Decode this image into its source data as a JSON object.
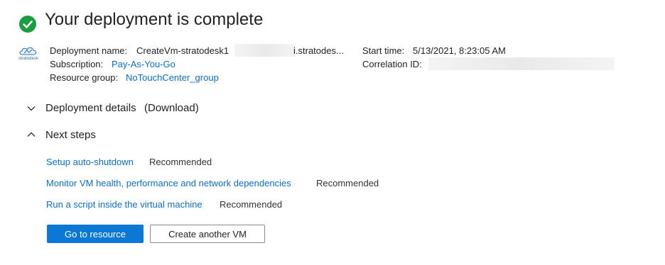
{
  "header": {
    "title": "Your deployment is complete"
  },
  "brand": {
    "logo_text": "stratodesk"
  },
  "deployment": {
    "name_label": "Deployment name:",
    "name_prefix": "CreateVm-stratodesk1",
    "name_suffix": "i.stratodes...",
    "subscription_label": "Subscription:",
    "subscription_value": "Pay-As-You-Go",
    "resource_group_label": "Resource group:",
    "resource_group_value": "NoTouchCenter_group",
    "start_time_label": "Start time:",
    "start_time_value": "5/13/2021, 8:23:05 AM",
    "correlation_label": "Correlation ID:"
  },
  "sections": {
    "details_label": "Deployment details",
    "download_link": "(Download)",
    "next_steps_label": "Next steps"
  },
  "next_steps": [
    {
      "link": "Setup auto-shutdown",
      "tag": "Recommended"
    },
    {
      "link": "Monitor VM health, performance and network dependencies",
      "tag": "Recommended"
    },
    {
      "link": "Run a script inside the virtual machine",
      "tag": "Recommended"
    }
  ],
  "actions": {
    "primary": "Go to resource",
    "secondary": "Create another VM"
  },
  "colors": {
    "accent": "#0a78d4",
    "link": "#0a6fc9",
    "success": "#1a9d3e"
  }
}
